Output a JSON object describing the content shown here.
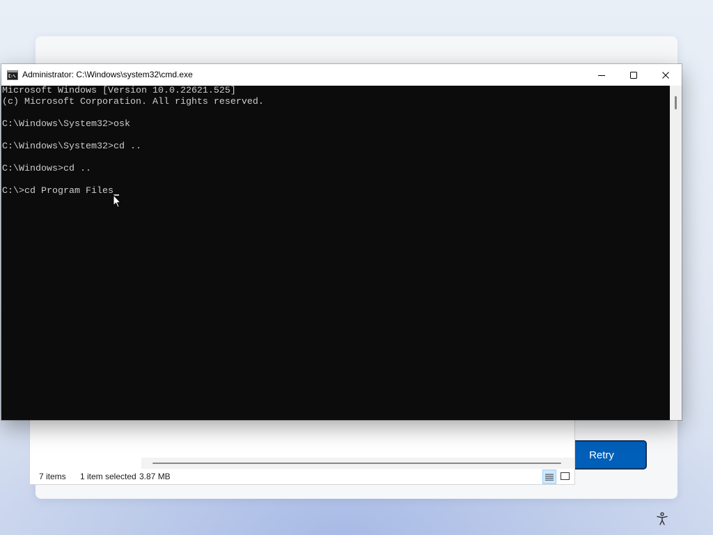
{
  "cmd_window": {
    "title": "Administrator: C:\\Windows\\system32\\cmd.exe",
    "console_lines": [
      "Microsoft Windows [Version 10.0.22621.525]",
      "(c) Microsoft Corporation. All rights reserved.",
      "",
      "C:\\Windows\\System32>osk",
      "",
      "C:\\Windows\\System32>cd ..",
      "",
      "C:\\Windows>cd ..",
      "",
      "C:\\>cd Program Files"
    ]
  },
  "explorer": {
    "status_items": "7 items",
    "status_selected": "1 item selected",
    "status_size": "3.87 MB"
  },
  "setup_dialog": {
    "retry_label": "Retry"
  },
  "icons": {
    "cmd": "cmd-icon",
    "minimize": "minimize-icon",
    "maximize": "maximize-icon",
    "close": "close-icon",
    "details_view": "details-view-icon",
    "large_icons_view": "large-icons-view-icon",
    "accessibility": "accessibility-icon",
    "mouse_pointer": "mouse-pointer-icon"
  },
  "colors": {
    "accent": "#005fb8",
    "console_background": "#0c0c0c",
    "console_text": "#cccccc",
    "selected_view_button": "#cce8ff"
  }
}
